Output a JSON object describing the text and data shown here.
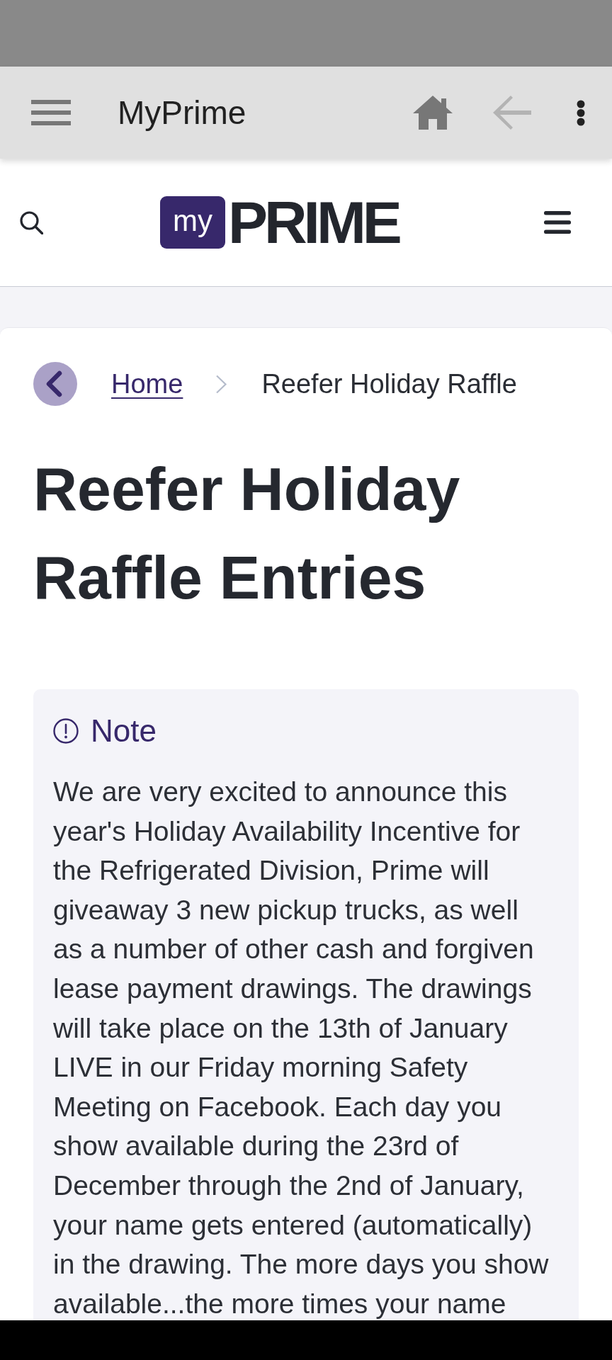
{
  "app_bar": {
    "title": "MyPrime",
    "back": {
      "disabled": true
    }
  },
  "site_header": {
    "logo": {
      "badge": "my",
      "wordmark": "PRIME"
    }
  },
  "breadcrumb": [
    {
      "label": "Home",
      "kind": "link"
    },
    {
      "label": "Reefer Holiday Raffle",
      "kind": "current"
    }
  ],
  "page_title": "Reefer Holiday Raffle Entries",
  "note": {
    "heading": "Note",
    "body": "We are very excited to announce this year's Holiday Availability Incentive for the Refrigerated Division, Prime will giveaway 3 new pickup trucks, as well as a number of other cash and forgiven lease payment drawings. The drawings will take place on the 13th of January LIVE in our Friday morning Safety Meeting on Facebook. Each day you show available during the 23rd of December through the 2nd of January, your name gets entered (automatically) in the drawing. The more days you show available...the more times your name"
  }
}
